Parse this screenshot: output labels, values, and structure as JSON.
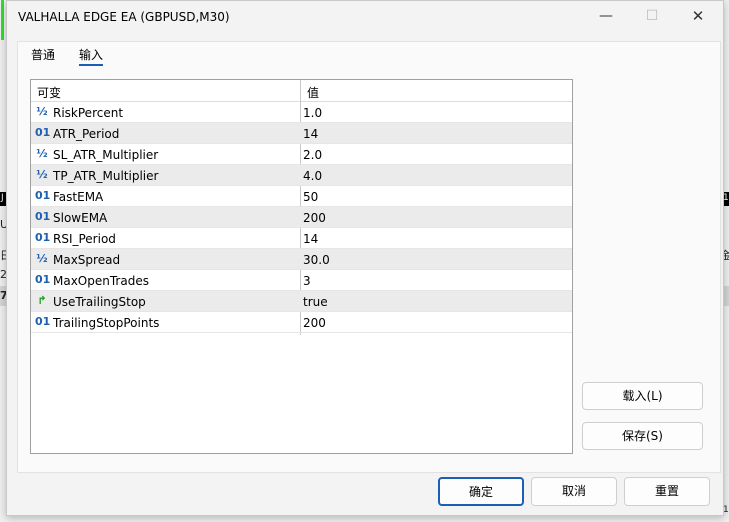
{
  "window": {
    "title": "VALHALLA EDGE EA (GBPUSD,M30)",
    "minimize_glyph": "—",
    "maximize_glyph": "☐",
    "close_glyph": "✕"
  },
  "tabs": [
    {
      "label": "普通",
      "active": false
    },
    {
      "label": "输入",
      "active": true
    }
  ],
  "grid": {
    "headers": {
      "variable": "可变",
      "value": "值"
    },
    "rows": [
      {
        "icon": "½",
        "icon_name": "double-icon",
        "name": "RiskPercent",
        "value": "1.0"
      },
      {
        "icon": "01",
        "icon_name": "integer-icon",
        "name": "ATR_Period",
        "value": "14"
      },
      {
        "icon": "½",
        "icon_name": "double-icon",
        "name": "SL_ATR_Multiplier",
        "value": "2.0"
      },
      {
        "icon": "½",
        "icon_name": "double-icon",
        "name": "TP_ATR_Multiplier",
        "value": "4.0"
      },
      {
        "icon": "01",
        "icon_name": "integer-icon",
        "name": "FastEMA",
        "value": "50"
      },
      {
        "icon": "01",
        "icon_name": "integer-icon",
        "name": "SlowEMA",
        "value": "200"
      },
      {
        "icon": "01",
        "icon_name": "integer-icon",
        "name": "RSI_Period",
        "value": "14"
      },
      {
        "icon": "½",
        "icon_name": "double-icon",
        "name": "MaxSpread",
        "value": "30.0"
      },
      {
        "icon": "01",
        "icon_name": "integer-icon",
        "name": "MaxOpenTrades",
        "value": "3"
      },
      {
        "icon": "↱",
        "icon_name": "bool-icon",
        "name": "UseTrailingStop",
        "value": "true"
      },
      {
        "icon": "01",
        "icon_name": "integer-icon",
        "name": "TrailingStopPoints",
        "value": "200"
      }
    ]
  },
  "side_buttons": {
    "load": "载入(L)",
    "save": "保存(S)"
  },
  "footer_buttons": {
    "ok": "确定",
    "cancel": "取消",
    "reset": "重置"
  },
  "background": {
    "frag_left_1": "J",
    "frag_left_2": "U",
    "frag_left_3": "日",
    "frag_left_4": "2(",
    "frag_left_5": "7.",
    "frag_right_1": "1",
    "frag_right_2": "金",
    "frag_right_3": "1"
  },
  "colors": {
    "accent": "#1a5fb4",
    "integer_icon": "#1f5fb0",
    "bool_icon": "#1ea01e"
  }
}
